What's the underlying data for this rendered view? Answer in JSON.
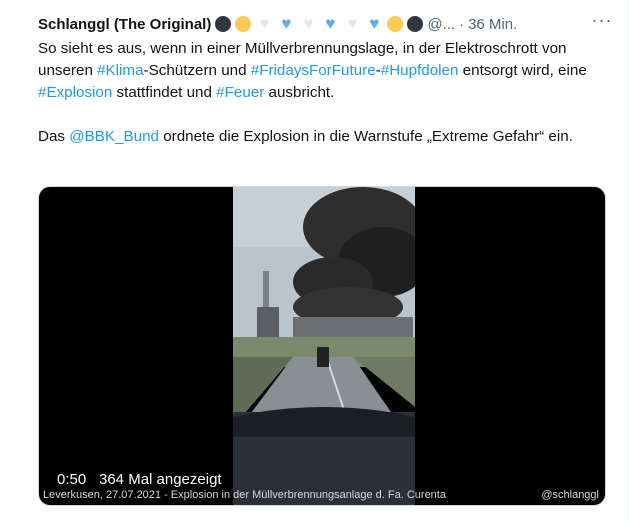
{
  "tweet": {
    "author_name": "Schlanggl (The Original)",
    "name_emojis": [
      "black-circle",
      "yellow-circle",
      "white-heart",
      "blue-heart",
      "white-heart",
      "blue-heart",
      "white-heart",
      "blue-heart",
      "yellow-circle",
      "black-circle"
    ],
    "handle": "@...",
    "time_separator": "·",
    "time": "36 Min.",
    "more_icon": "more-dots-icon",
    "text": {
      "p1_a": "So sieht es aus, wenn in einer Müllverbrennungslage, in der Elektroschrott von unseren ",
      "tag_klima": "#Klima",
      "p1_b": "-Schützern und ",
      "tag_fff": "#FridaysForFuture",
      "p1_c": "-",
      "tag_hupfdolen": "#Hupfdolen",
      "p1_d": " entsorgt wird, eine ",
      "tag_explosion": "#Explosion",
      "p1_e": " stattfindet und ",
      "tag_feuer": "#Feuer",
      "p1_f": " ausbricht.",
      "p2_a": "Das ",
      "mention_bbk": "@BBK_Bund",
      "p2_b": " ordnete die Explosion in die Warnstufe „Extreme Gefahr“ ein."
    },
    "video": {
      "duration": "0:50",
      "views": "364 Mal angezeigt",
      "caption": "Leverkusen, 27.07.2021 - Explosion in der Müllverbrennungsanlage d. Fa. Curenta",
      "watermark": "@schlanggl"
    }
  },
  "colors": {
    "link": "#1d9bf0",
    "text": "#0f1419",
    "secondary": "#536471"
  }
}
